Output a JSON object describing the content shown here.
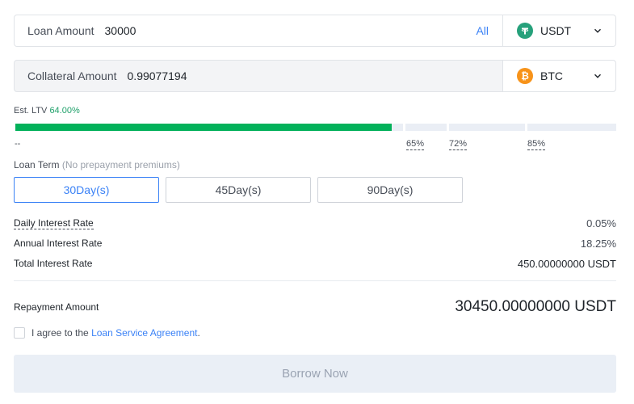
{
  "loan": {
    "label": "Loan Amount",
    "value": "30000",
    "all_label": "All",
    "coin": {
      "name": "USDT",
      "icon": "tether-icon",
      "color": "#26a17b"
    }
  },
  "collateral": {
    "label": "Collateral Amount",
    "value": "0.99077194",
    "coin": {
      "name": "BTC",
      "icon": "bitcoin-icon",
      "color": "#f7931a"
    }
  },
  "ltv": {
    "label": "Est. LTV",
    "value": "64.00%",
    "fill_percent": 64,
    "color": "#02b15a",
    "start_label": "--",
    "thresholds": [
      "65%",
      "72%",
      "85%"
    ]
  },
  "loan_term": {
    "label": "Loan Term",
    "note": "(No prepayment premiums)",
    "options": [
      "30Day(s)",
      "45Day(s)",
      "90Day(s)"
    ],
    "selected": "30Day(s)"
  },
  "interest": {
    "daily_label": "Daily Interest Rate",
    "daily_value": "0.05%",
    "annual_label": "Annual Interest Rate",
    "annual_value": "18.25%",
    "total_label": "Total Interest Rate",
    "total_value": "450.00000000 USDT"
  },
  "repayment": {
    "label": "Repayment Amount",
    "value": "30450.00000000 USDT"
  },
  "agreement": {
    "prefix": "I agree to the",
    "link": "Loan Service Agreement",
    "suffix": ".",
    "checked": false
  },
  "borrow_button": "Borrow Now"
}
